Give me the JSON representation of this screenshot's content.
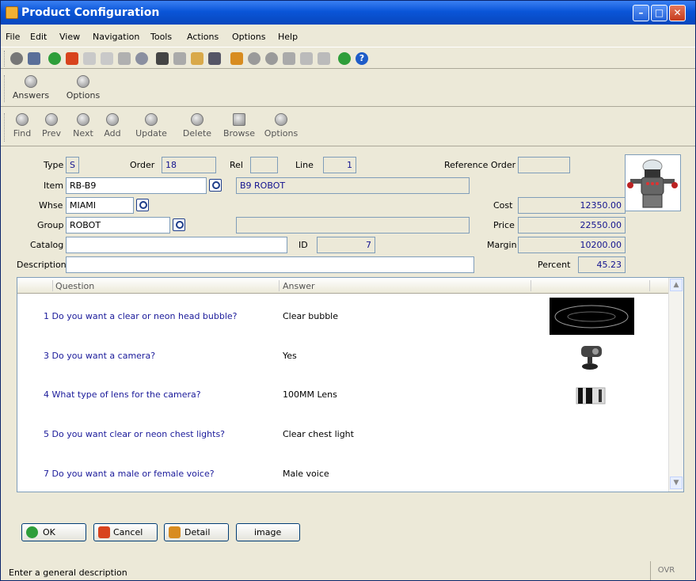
{
  "window": {
    "title": "Product Configuration"
  },
  "menu": [
    "File",
    "Edit",
    "View",
    "Navigation",
    "Tools",
    "Actions",
    "Options",
    "Help"
  ],
  "toolbar_answers": [
    {
      "label": "Answers",
      "icon": "add-circle-icon"
    },
    {
      "label": "Options",
      "icon": "add-circle-icon"
    }
  ],
  "toolbar_nav": [
    {
      "label": "Find",
      "icon": "magnifier-icon"
    },
    {
      "label": "Prev",
      "icon": "arrow-left-icon"
    },
    {
      "label": "Next",
      "icon": "arrow-right-icon"
    },
    {
      "label": "Add",
      "icon": "add-circle-icon"
    },
    {
      "label": "Update",
      "icon": "refresh-icon"
    },
    {
      "label": "Delete",
      "icon": "delete-circle-icon"
    },
    {
      "label": "Browse",
      "icon": "browse-icon"
    },
    {
      "label": "Options",
      "icon": "wrench-icon"
    }
  ],
  "form": {
    "type_label": "Type",
    "type_value": "S",
    "order_label": "Order",
    "order_value": "18",
    "rel_label": "Rel",
    "rel_value": "",
    "line_label": "Line",
    "line_value": "1",
    "ref_order_label": "Reference Order",
    "ref_order_value": "",
    "item_label": "Item",
    "item_value": "RB-B9",
    "item_desc": "B9 ROBOT",
    "whse_label": "Whse",
    "whse_value": "MIAMI",
    "group_label": "Group",
    "group_value": "ROBOT",
    "group_desc": "",
    "catalog_label": "Catalog",
    "catalog_value": "",
    "id_label": "ID",
    "id_value": "7",
    "description_label": "Description",
    "description_value": "",
    "cost_label": "Cost",
    "cost_value": "12350.00",
    "price_label": "Price",
    "price_value": "22550.00",
    "margin_label": "Margin",
    "margin_value": "10200.00",
    "percent_label": "Percent",
    "percent_value": "45.23"
  },
  "grid": {
    "col_question": "Question",
    "col_answer": "Answer",
    "rows": [
      {
        "q": "1  Do you want a clear or neon head bubble?",
        "a": "Clear bubble"
      },
      {
        "q": "3  Do you want a camera?",
        "a": "Yes"
      },
      {
        "q": "4  What type of lens for the camera?",
        "a": "100MM Lens"
      },
      {
        "q": "5  Do you want clear or neon chest lights?",
        "a": "Clear chest light"
      },
      {
        "q": "7  Do you want a male or female voice?",
        "a": "Male voice"
      }
    ]
  },
  "buttons": {
    "ok": "OK",
    "cancel": "Cancel",
    "detail": "Detail",
    "image": "image"
  },
  "status": {
    "message": "Enter a general description",
    "mode": "OVR"
  }
}
